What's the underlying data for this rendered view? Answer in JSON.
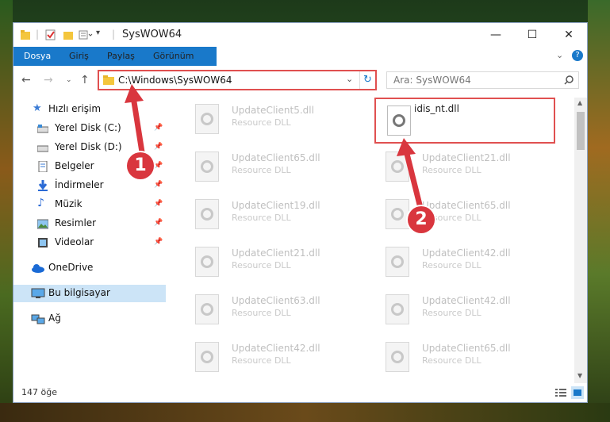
{
  "window": {
    "title": "SysWOW64"
  },
  "ribbon": {
    "tabs": [
      "Dosya",
      "Giriş",
      "Paylaş",
      "Görünüm"
    ]
  },
  "address": {
    "path": "C:\\Windows\\SysWOW64"
  },
  "search": {
    "placeholder": "Ara: SysWOW64"
  },
  "sidebar": {
    "quick_access": "Hızlı erişim",
    "items": [
      "Yerel Disk (C:)",
      "Yerel Disk (D:)",
      "Belgeler",
      "İndirmeler",
      "Müzik",
      "Resimler",
      "Videolar"
    ],
    "onedrive": "OneDrive",
    "this_pc": "Bu bilgisayar",
    "network": "Ağ"
  },
  "files": {
    "left": [
      {
        "name": "UpdateClient5.dll",
        "type": "Resource DLL"
      },
      {
        "name": "UpdateClient65.dll",
        "type": "Resource DLL"
      },
      {
        "name": "UpdateClient19.dll",
        "type": "Resource DLL"
      },
      {
        "name": "UpdateClient21.dll",
        "type": "Resource DLL"
      },
      {
        "name": "UpdateClient63.dll",
        "type": "Resource DLL"
      },
      {
        "name": "UpdateClient42.dll",
        "type": "Resource DLL"
      }
    ],
    "right": [
      {
        "name": "idis_nt.dll",
        "type": ""
      },
      {
        "name": "UpdateClient21.dll",
        "type": "Resource DLL"
      },
      {
        "name": "UpdateClient65.dll",
        "type": "Resource DLL"
      },
      {
        "name": "UpdateClient42.dll",
        "type": "Resource DLL"
      },
      {
        "name": "UpdateClient42.dll",
        "type": "Resource DLL"
      },
      {
        "name": "UpdateClient65.dll",
        "type": "Resource DLL"
      }
    ]
  },
  "status": {
    "count": "147 öğe"
  },
  "annotations": {
    "badge1": "1",
    "badge2": "2"
  },
  "colors": {
    "accent": "#1979ca",
    "highlight": "#e05050",
    "badge": "#d9363e"
  }
}
